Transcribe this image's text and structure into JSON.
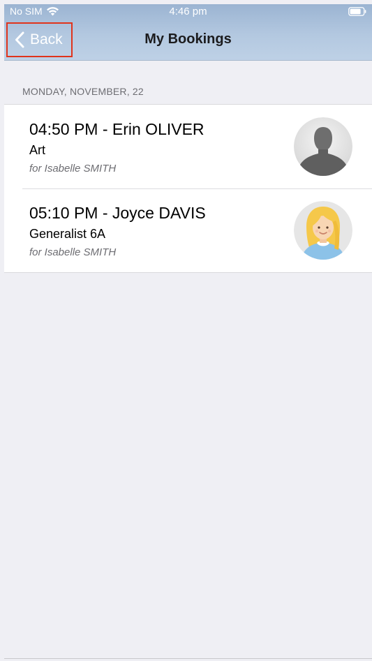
{
  "status_bar": {
    "carrier": "No SIM",
    "time": "4:46 pm",
    "wifi_icon": "wifi-icon",
    "battery_icon": "battery-icon"
  },
  "nav": {
    "back_label": "Back",
    "back_icon": "chevron-left-icon",
    "title": "My Bookings"
  },
  "section": {
    "header": "MONDAY, NOVEMBER, 22"
  },
  "bookings": [
    {
      "title": "04:50 PM - Erin OLIVER",
      "subject": "Art",
      "for": "for Isabelle SMITH",
      "avatar": "default-person-avatar"
    },
    {
      "title": "05:10 PM - Joyce DAVIS",
      "subject": "Generalist 6A",
      "for": "for Isabelle SMITH",
      "avatar": "blonde-woman-avatar"
    }
  ],
  "colors": {
    "nav_gradient_top": "#9bb4d2",
    "nav_gradient_bottom": "#bed1e6",
    "highlight_border": "#e0341c",
    "background": "#efeff4"
  }
}
